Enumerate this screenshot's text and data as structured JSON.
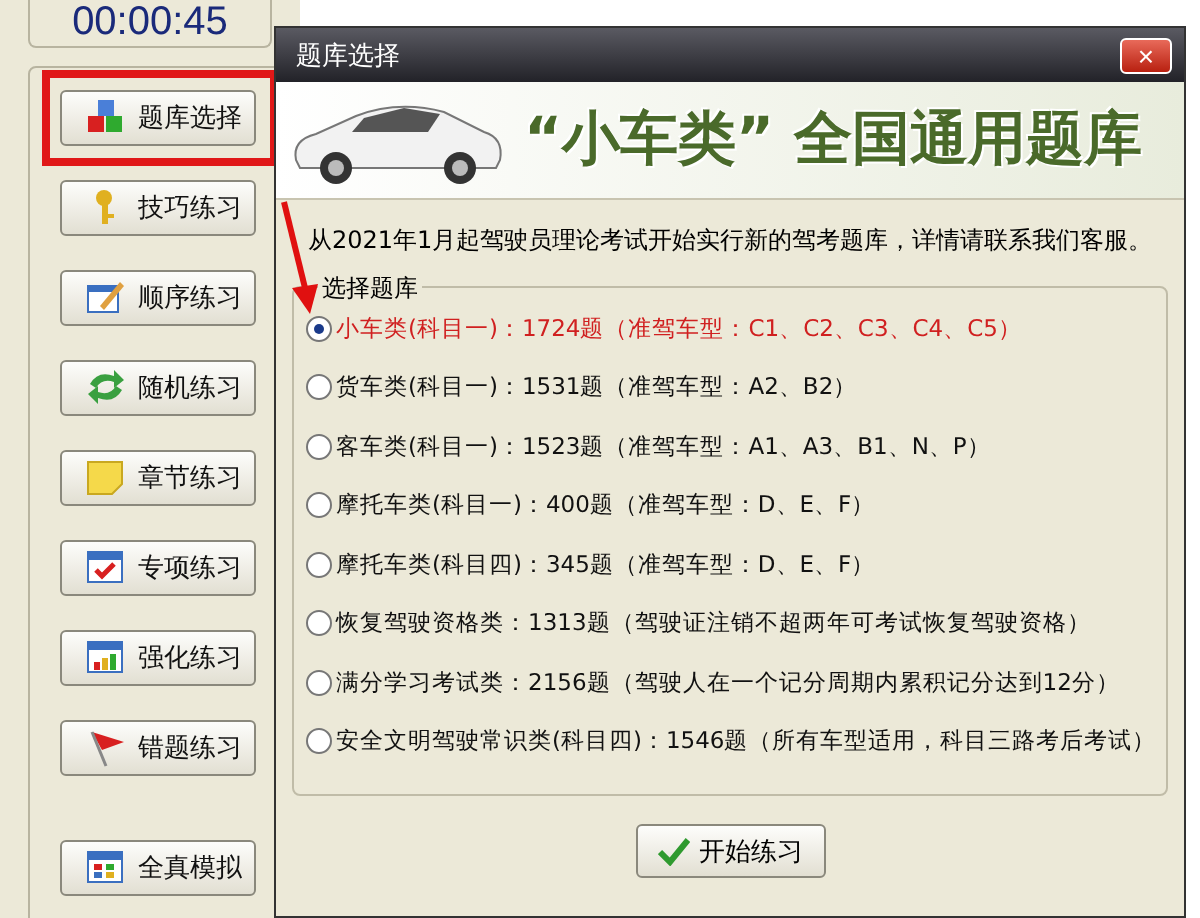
{
  "timer": {
    "value": "00:00:45"
  },
  "sidebar": {
    "buttons": [
      {
        "label": "题库选择",
        "kind": "cubes",
        "highlighted": true
      },
      {
        "label": "技巧练习",
        "kind": "key",
        "highlighted": false
      },
      {
        "label": "顺序练习",
        "kind": "pencil",
        "highlighted": false
      },
      {
        "label": "随机练习",
        "kind": "arrows",
        "highlighted": false
      },
      {
        "label": "章节练习",
        "kind": "note",
        "highlighted": false
      },
      {
        "label": "专项练习",
        "kind": "check",
        "highlighted": false
      },
      {
        "label": "强化练习",
        "kind": "bars",
        "highlighted": false
      },
      {
        "label": "错题练习",
        "kind": "flag",
        "highlighted": false
      },
      {
        "label": "全真模拟",
        "kind": "grid",
        "highlighted": false
      }
    ]
  },
  "dialog": {
    "title": "题库选择",
    "close": "×",
    "banner": "“小车类” 全国通用题库",
    "notice": "从2021年1月起驾驶员理论考试开始实行新的驾考题库，详情请联系我们客服。",
    "group_label": "选择题库",
    "options": [
      {
        "label": "小车类(科目一)：1724题（准驾车型：C1、C2、C3、C4、C5）",
        "selected": true
      },
      {
        "label": "货车类(科目一)：1531题（准驾车型：A2、B2）",
        "selected": false
      },
      {
        "label": "客车类(科目一)：1523题（准驾车型：A1、A3、B1、N、P）",
        "selected": false
      },
      {
        "label": "摩托车类(科目一)：400题（准驾车型：D、E、F）",
        "selected": false
      },
      {
        "label": "摩托车类(科目四)：345题（准驾车型：D、E、F）",
        "selected": false
      },
      {
        "label": "恢复驾驶资格类：1313题（驾驶证注销不超两年可考试恢复驾驶资格）",
        "selected": false
      },
      {
        "label": "满分学习考试类：2156题（驾驶人在一个记分周期内累积记分达到12分）",
        "selected": false
      },
      {
        "label": "安全文明驾驶常识类(科目四)：1546题（所有车型适用，科目三路考后考试）",
        "selected": false
      }
    ],
    "start_button": "开始练习"
  }
}
